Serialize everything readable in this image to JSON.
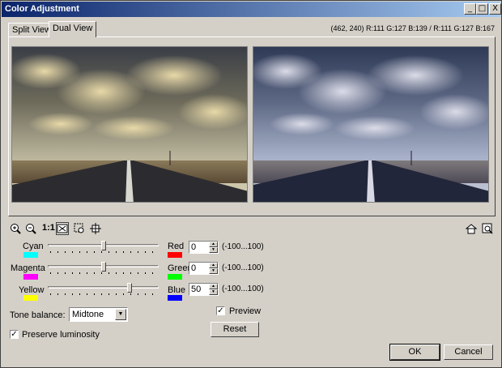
{
  "window": {
    "title": "Color Adjustment"
  },
  "titlebar_buttons": {
    "minimize": "_",
    "maximize": "□",
    "close": "X"
  },
  "tabs": [
    {
      "label": "Split View",
      "active": false
    },
    {
      "label": "Dual View",
      "active": true
    }
  ],
  "pixel_info": "(462, 240) R:111 G:127 B:139 / R:111 G:127 B:167",
  "toolbar": {
    "left_icons": [
      "zoom-in-icon",
      "zoom-out-icon",
      "actual-size-icon",
      "fit-to-window-icon",
      "pan-icon",
      "navigate-icon"
    ],
    "actual_size_label": "1:1",
    "right_icons": [
      "preview-home-icon",
      "zoom-tool-icon"
    ]
  },
  "sliders": [
    {
      "left": "Cyan",
      "right": "Red",
      "left_color": "#00ffff",
      "right_color": "#ff0000",
      "value": "0",
      "range": "(-100...100)",
      "position": 0
    },
    {
      "left": "Magenta",
      "right": "Green",
      "left_color": "#ff00ff",
      "right_color": "#00ff00",
      "value": "0",
      "range": "(-100...100)",
      "position": 0
    },
    {
      "left": "Yellow",
      "right": "Blue",
      "left_color": "#ffff00",
      "right_color": "#0000ff",
      "value": "50",
      "range": "(-100...100)",
      "position": 50
    }
  ],
  "tone_balance": {
    "label": "Tone balance:",
    "value": "Midtone"
  },
  "preserve_luminosity": {
    "label": "Preserve luminosity",
    "checked": true
  },
  "preview": {
    "label": "Preview",
    "checked": true
  },
  "buttons": {
    "reset": "Reset",
    "ok": "OK",
    "cancel": "Cancel"
  }
}
